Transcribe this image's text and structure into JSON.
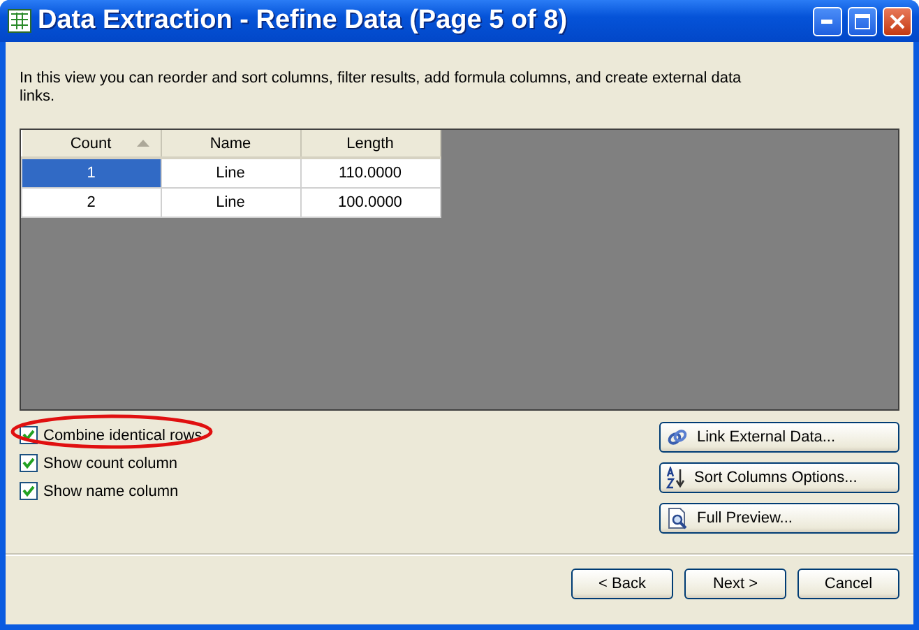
{
  "window": {
    "title": "Data Extraction - Refine Data (Page 5 of 8)"
  },
  "description": "In this view you can reorder and sort columns, filter results, add formula columns, and create external data links.",
  "table": {
    "columns": [
      {
        "label": "Count",
        "sorted": true
      },
      {
        "label": "Name",
        "sorted": false
      },
      {
        "label": "Length",
        "sorted": false
      }
    ],
    "rows": [
      {
        "cells": [
          "1",
          "Line",
          "110.0000"
        ],
        "selected": true
      },
      {
        "cells": [
          "2",
          "Line",
          "100.0000"
        ],
        "selected": false
      }
    ]
  },
  "options": [
    {
      "label": "Combine identical rows",
      "checked": true,
      "circled": true
    },
    {
      "label": "Show count column",
      "checked": true,
      "circled": false
    },
    {
      "label": "Show name column",
      "checked": true,
      "circled": false
    }
  ],
  "actions": [
    {
      "label": "Link External Data...",
      "kind": "link"
    },
    {
      "label": "Sort Columns Options...",
      "kind": "sort"
    },
    {
      "label": "Full Preview...",
      "kind": "preview"
    }
  ],
  "buttons": [
    "< Back",
    "Next >",
    "Cancel"
  ]
}
